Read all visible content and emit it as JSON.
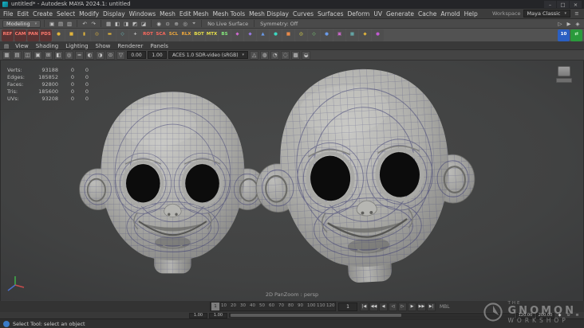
{
  "window": {
    "title": "untitled* - Autodesk MAYA 2024.1: untitled",
    "min": "–",
    "max": "□",
    "close": "×"
  },
  "menubar": {
    "menus": [
      "File",
      "Edit",
      "Create",
      "Select",
      "Modify",
      "Display",
      "Windows",
      "Mesh",
      "Edit Mesh",
      "Mesh Tools",
      "Mesh Display",
      "Curves",
      "Surfaces",
      "Deform",
      "UV",
      "Generate",
      "Cache",
      "Arnold",
      "Help"
    ],
    "workspace_label": "Workspace",
    "workspace_value": "Maya Classic",
    "workspace_chevron": "▾",
    "settings_icon": "≡"
  },
  "statusline": {
    "mode": "Modeling",
    "chevron": "▾",
    "icons_a": [
      "▣",
      "▤",
      "▥"
    ],
    "icons_b": [
      "↶",
      "↷"
    ],
    "icons_c": [
      "▦",
      "◧",
      "◨",
      "◩",
      "◪"
    ],
    "icons_d": [
      "◉",
      "⊙",
      "⊕",
      "◎",
      "⌖"
    ],
    "icons_e": [
      "▷",
      "▶",
      "◈"
    ],
    "no_live_surface": "No Live Surface",
    "symmetry": "Symmetry: Off"
  },
  "shelf": {
    "items": [
      {
        "t": "REF",
        "fg": "#ff7a6e",
        "bg": "#5a3434"
      },
      {
        "t": "CAM",
        "fg": "#ff7a6e",
        "bg": "#5a3434"
      },
      {
        "t": "PAN",
        "fg": "#ff7a6e",
        "bg": "#5a3434"
      },
      {
        "t": "PDS",
        "fg": "#ff7a6e",
        "bg": "#5a3434"
      },
      {
        "t": "●",
        "fg": "#e0b43c",
        "bg": "#4e4e4e"
      },
      {
        "t": "■",
        "fg": "#e0b43c",
        "bg": "#4e4e4e"
      },
      {
        "t": "▮",
        "fg": "#e0b43c",
        "bg": "#4e4e4e"
      },
      {
        "t": "◎",
        "fg": "#e0b43c",
        "bg": "#4e4e4e"
      },
      {
        "t": "▬",
        "fg": "#e0b43c",
        "bg": "#4e4e4e"
      },
      {
        "t": "◇",
        "fg": "#6cc6c6",
        "bg": "#4e4e4e"
      },
      {
        "t": "+",
        "fg": "#cccccc",
        "bg": "#4e4e4e"
      },
      {
        "t": "ROT",
        "fg": "#ff6a5e",
        "bg": "#4e4e4e"
      },
      {
        "t": "SCA",
        "fg": "#ff6a5e",
        "bg": "#4e4e4e"
      },
      {
        "t": "SCL",
        "fg": "#f0a83c",
        "bg": "#4e4e4e"
      },
      {
        "t": "RLX",
        "fg": "#f0a83c",
        "bg": "#4e4e4e"
      },
      {
        "t": "BOT",
        "fg": "#e8e04a",
        "bg": "#4e4e4e"
      },
      {
        "t": "MTX",
        "fg": "#e8e04a",
        "bg": "#4e4e4e"
      },
      {
        "t": "BS",
        "fg": "#84e87c",
        "bg": "#4e4e4e"
      },
      {
        "t": "◆",
        "fg": "#d06ad0",
        "bg": "#4e4e4e"
      },
      {
        "t": "◆",
        "fg": "#9a7ae8",
        "bg": "#4e4e4e"
      },
      {
        "t": "▲",
        "fg": "#6a9ae8",
        "bg": "#4e4e4e"
      },
      {
        "t": "●",
        "fg": "#3cd8c0",
        "bg": "#4e4e4e"
      },
      {
        "t": "■",
        "fg": "#e88a4a",
        "bg": "#4e4e4e"
      },
      {
        "t": "◎",
        "fg": "#e8e04a",
        "bg": "#4e4e4e"
      },
      {
        "t": "◇",
        "fg": "#84e87c",
        "bg": "#4e4e4e"
      },
      {
        "t": "●",
        "fg": "#6a9ae8",
        "bg": "#4e4e4e"
      },
      {
        "t": "▣",
        "fg": "#d06ad0",
        "bg": "#4e4e4e"
      },
      {
        "t": "▦",
        "fg": "#6cc6c6",
        "bg": "#4e4e4e"
      },
      {
        "t": "◆",
        "fg": "#e0b43c",
        "bg": "#4e4e4e"
      },
      {
        "t": "●",
        "fg": "#c05ad0",
        "bg": "#4e4e4e"
      }
    ],
    "right": [
      {
        "t": "10",
        "fg": "#ffffff",
        "bg": "#2a5fc2"
      },
      {
        "t": "⇄",
        "fg": "#d8ffd8",
        "bg": "#2a9a3c"
      }
    ]
  },
  "panel": {
    "pane_icon": "▤",
    "menus": [
      "View",
      "Shading",
      "Lighting",
      "Show",
      "Renderer",
      "Panels"
    ],
    "icons_a": [
      "▦",
      "▤",
      "◫",
      "▣",
      "⊞",
      "◧",
      "◎",
      "≈",
      "◐",
      "◑",
      "⊙",
      "▽"
    ],
    "exposure": "0.00",
    "gamma": "1.00",
    "colorspace": "ACES 1.0 SDR-video (sRGB)",
    "chevron": "▾",
    "icons_b": [
      "△",
      "◍",
      "◔",
      "◌",
      "▩",
      "◒"
    ]
  },
  "hud": {
    "rows": [
      {
        "label": "Verts:",
        "v1": "93188",
        "v2": "0",
        "v3": "0"
      },
      {
        "label": "Edges:",
        "v1": "185852",
        "v2": "0",
        "v3": "0"
      },
      {
        "label": "Faces:",
        "v1": "92800",
        "v2": "0",
        "v3": "0"
      },
      {
        "label": "Tris:",
        "v1": "185600",
        "v2": "0",
        "v3": "0"
      },
      {
        "label": "UVs:",
        "v1": "93208",
        "v2": "0",
        "v3": "0"
      }
    ],
    "camera_label": "2D PanZoom : persp"
  },
  "timeline": {
    "ticks": [
      "1",
      "10",
      "20",
      "30",
      "40",
      "50",
      "60",
      "70",
      "80",
      "90",
      "100",
      "110",
      "120"
    ],
    "current": "1",
    "playback": [
      "|◀",
      "◀◀",
      "◀",
      "◁",
      "▷",
      "▶",
      "▶▶",
      "▶|"
    ],
    "extra": "MBL"
  },
  "range": {
    "f1": "1.00",
    "f2": "1.00",
    "f3": "120.00",
    "f4": "200.00",
    "icons": [
      "◆",
      "⊙",
      "≡"
    ]
  },
  "cmdline": {
    "help": "Select Tool: select an object"
  },
  "watermark": {
    "the": "THE",
    "line1": "GNOMON",
    "line2": "WORKSHOP"
  }
}
